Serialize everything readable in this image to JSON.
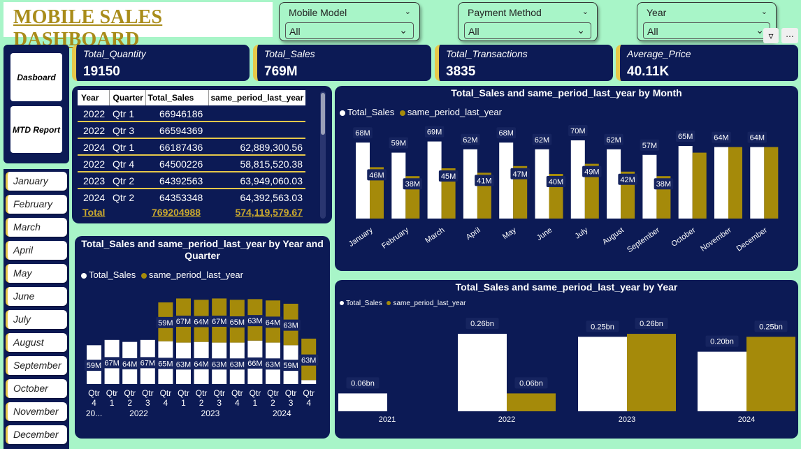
{
  "header": {
    "title": "MOBILE SALES DASHBOARD"
  },
  "slicers": [
    {
      "label": "Mobile Model",
      "value": "All"
    },
    {
      "label": "Payment Method",
      "value": "All"
    },
    {
      "label": "Year",
      "value": "All"
    }
  ],
  "toolbar": {
    "more": "..."
  },
  "kpis": [
    {
      "title": "Total_Quantity",
      "value": "19150"
    },
    {
      "title": "Total_Sales",
      "value": "769M"
    },
    {
      "title": "Total_Transactions",
      "value": "3835"
    },
    {
      "title": "Average_Price",
      "value": "40.11K"
    }
  ],
  "nav": {
    "dashboard": "Dasboard",
    "mtd": "MTD Report"
  },
  "months": [
    "January",
    "February",
    "March",
    "April",
    "May",
    "June",
    "July",
    "August",
    "September",
    "October",
    "November",
    "December"
  ],
  "table": {
    "headers": [
      "Year",
      "Quarter",
      "Total_Sales",
      "same_period_last_year"
    ],
    "rows": [
      [
        "2022",
        "Qtr 1",
        "66946186",
        ""
      ],
      [
        "2022",
        "Qtr 3",
        "66594369",
        ""
      ],
      [
        "2024",
        "Qtr 1",
        "66187436",
        "62,889,300.56"
      ],
      [
        "2022",
        "Qtr 4",
        "64500226",
        "58,815,520.38"
      ],
      [
        "2023",
        "Qtr 2",
        "64392563",
        "63,949,060.03"
      ],
      [
        "2024",
        "Qtr 2",
        "64353348",
        "64,392,563.03"
      ]
    ],
    "total": [
      "Total",
      "",
      "769204988",
      "574,119,579.67"
    ]
  },
  "colors": {
    "total_sales": "#ffffff",
    "same_period_last_year": "#a58a0a",
    "panel": "#0c1a55",
    "background": "#a8f5c8",
    "accent": "#e6c84a"
  },
  "chart_data": [
    {
      "type": "bar",
      "title": "Total_Sales and same_period_last_year by Month",
      "legend": [
        "Total_Sales",
        "same_period_last_year"
      ],
      "categories": [
        "January",
        "February",
        "March",
        "April",
        "May",
        "June",
        "July",
        "August",
        "September",
        "October",
        "November",
        "December"
      ],
      "series": [
        {
          "name": "Total_Sales",
          "values": [
            68,
            59,
            69,
            62,
            68,
            62,
            70,
            62,
            57,
            65,
            64,
            64
          ],
          "labels": [
            "68M",
            "59M",
            "69M",
            "62M",
            "68M",
            "62M",
            "70M",
            "62M",
            "57M",
            "",
            "64M",
            "64M"
          ]
        },
        {
          "name": "same_period_last_year",
          "values": [
            46,
            38,
            45,
            41,
            47,
            40,
            49,
            42,
            38,
            59,
            64,
            64
          ],
          "labels": [
            "46M",
            "38M",
            "45M",
            "41M",
            "47M",
            "40M",
            "49M",
            "42M",
            "38M",
            "",
            "",
            ""
          ]
        }
      ],
      "extra_labels": [
        "65M"
      ],
      "ylim": [
        0,
        75
      ]
    },
    {
      "type": "bar",
      "title": "Total_Sales and same_period_last_year by Year and Quarter",
      "legend": [
        "Total_Sales",
        "same_period_last_year"
      ],
      "categories": [
        "Qtr 4",
        "Qtr 1",
        "Qtr 2",
        "Qtr 3",
        "Qtr 4",
        "Qtr 1",
        "Qtr 2",
        "Qtr 3",
        "Qtr 4",
        "Qtr 1",
        "Qtr 2",
        "Qtr 3",
        "Qtr 4"
      ],
      "year_groups": [
        {
          "label": "20...",
          "span": 1
        },
        {
          "label": "2022",
          "span": 4
        },
        {
          "label": "2023",
          "span": 4
        },
        {
          "label": "2024",
          "span": 4
        }
      ],
      "series": [
        {
          "name": "Total_Sales",
          "values": [
            59,
            67,
            64,
            67,
            65,
            63,
            64,
            63,
            63,
            66,
            63,
            59,
            6
          ],
          "labels": [
            "59M",
            "67M",
            "64M",
            "67M",
            "65M",
            "63M",
            "64M",
            "63M",
            "63M",
            "66M",
            "63M",
            "59M",
            ""
          ]
        },
        {
          "name": "same_period_last_year",
          "values": [
            0,
            0,
            0,
            0,
            59,
            67,
            64,
            67,
            65,
            63,
            64,
            63,
            63
          ],
          "labels": [
            "",
            "",
            "",
            "",
            "59M",
            "67M",
            "64M",
            "67M",
            "65M",
            "63M",
            "64M",
            "63M",
            "63M"
          ]
        }
      ],
      "stacked": true
    },
    {
      "type": "bar",
      "title": "Total_Sales and same_period_last_year by Year",
      "legend": [
        "Total_Sales",
        "same_period_last_year"
      ],
      "categories": [
        "2021",
        "2022",
        "2023",
        "2024"
      ],
      "series": [
        {
          "name": "Total_Sales",
          "values": [
            0.06,
            0.26,
            0.25,
            0.2
          ],
          "labels": [
            "0.06bn",
            "0.26bn",
            "0.25bn",
            "0.20bn"
          ]
        },
        {
          "name": "same_period_last_year",
          "values": [
            0,
            0.06,
            0.26,
            0.25
          ],
          "labels": [
            "",
            "0.06bn",
            "0.26bn",
            "0.25bn"
          ]
        }
      ],
      "ylim": [
        0,
        0.3
      ]
    }
  ]
}
